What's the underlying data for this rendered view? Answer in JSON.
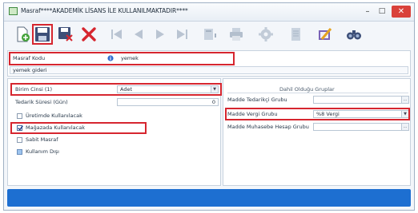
{
  "window": {
    "title": "Masraf****AKADEMİK LİSANS İLE KULLANILMAKTADIR****",
    "controls": {
      "minimize": "–",
      "maximize": "□",
      "close": "✕"
    }
  },
  "header": {
    "code_label": "Masraf Kodu",
    "code_value": "yemek",
    "desc_value": "yemek gideri"
  },
  "left": {
    "unit_label": "Birim Cinsi (1)",
    "unit_value": "Adet",
    "lead_time_label": "Tedarik Süresi (Gün)",
    "lead_time_value": "0",
    "checkboxes": [
      {
        "label": "Üretimde Kullanılacak"
      },
      {
        "label": "Mağazada Kullanılacak"
      },
      {
        "label": "Sabit Masraf"
      },
      {
        "label": "Kullanım Dışı"
      }
    ]
  },
  "right": {
    "group_title": "Dahil Olduğu Gruplar",
    "supply_group_label": "Madde Tedarikçi Grubu",
    "tax_group_label": "Madde Vergi Grubu",
    "tax_group_value": "%8 Vergi",
    "accounting_group_label": "Madde Muhasebe Hesap Grubu"
  },
  "colors": {
    "highlight": "#d6262f",
    "statusbar": "#1d6fd1"
  }
}
